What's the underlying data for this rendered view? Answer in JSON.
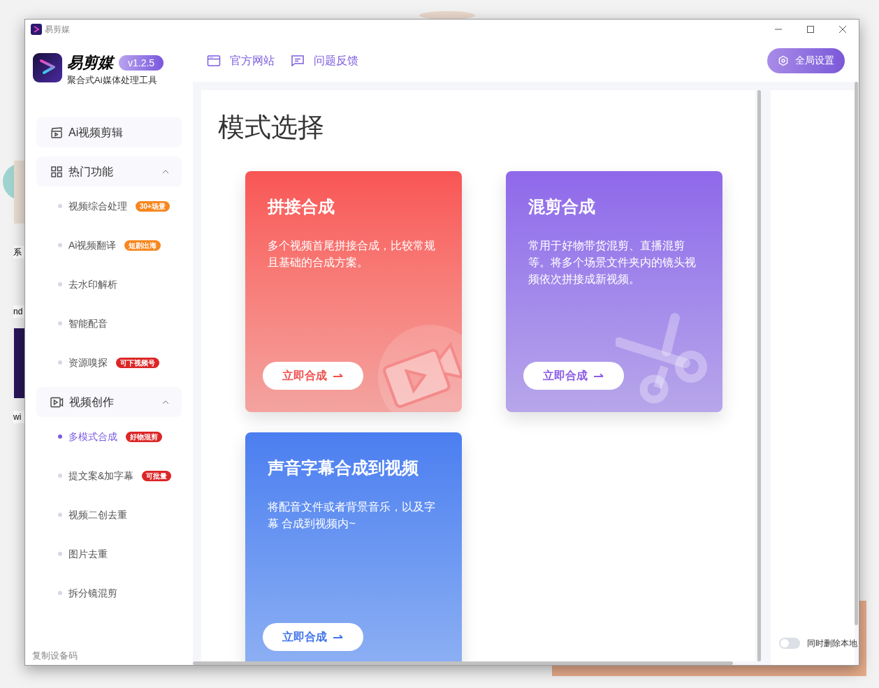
{
  "background_window": {
    "texts": [
      "系",
      "nd",
      "wi"
    ]
  },
  "window": {
    "title": "易剪媒"
  },
  "brand": {
    "name": "易剪媒",
    "version": "v1.2.5",
    "tagline": "聚合式Ai媒体处理工具"
  },
  "sidebar": {
    "items": [
      {
        "kind": "link",
        "label": "Ai视频剪辑"
      },
      {
        "kind": "group",
        "label": "热门功能",
        "expanded": true,
        "children": [
          {
            "label": "视频综合处理",
            "selected": false,
            "badge": {
              "text": "30+场景",
              "color": "#f7861e"
            }
          },
          {
            "label": "Ai视频翻译",
            "selected": false,
            "badge": {
              "text": "短剧出海",
              "color": "#f7861e"
            }
          },
          {
            "label": "去水印解析",
            "selected": false
          },
          {
            "label": "智能配音",
            "selected": false
          },
          {
            "label": "资源嗅探",
            "selected": false,
            "badge": {
              "text": "可下视频号",
              "color": "#dc2626"
            }
          }
        ]
      },
      {
        "kind": "group",
        "label": "视频创作",
        "expanded": true,
        "children": [
          {
            "label": "多模式合成",
            "selected": true,
            "badge": {
              "text": "好物混剪",
              "color": "#dc2626"
            }
          },
          {
            "label": "提文案&加字幕",
            "selected": false,
            "badge": {
              "text": "可批量",
              "color": "#dc2626"
            }
          },
          {
            "label": "视频二创去重",
            "selected": false
          },
          {
            "label": "图片去重",
            "selected": false
          },
          {
            "label": "拆分镜混剪",
            "selected": false
          }
        ]
      }
    ],
    "footer": "复制设备码"
  },
  "top_links": [
    {
      "label": "官方网站"
    },
    {
      "label": "问题反馈"
    }
  ],
  "settings_button": "全局设置",
  "page_title": "模式选择",
  "cards": [
    {
      "kind": "red",
      "title": "拼接合成",
      "description": "多个视频首尾拼接合成，比较常规且基础的合成方案。",
      "button": "立即合成"
    },
    {
      "kind": "purple",
      "title": "混剪合成",
      "description": "常用于好物带货混剪、直播混剪等。将多个场景文件夹内的镜头视频依次拼接成新视频。",
      "button": "立即合成"
    },
    {
      "kind": "blue",
      "title": "声音字幕合成到视频",
      "description": "将配音文件或者背景音乐，以及字幕 合成到视频内~",
      "button": "立即合成"
    }
  ],
  "right_panel": {
    "toggle": {
      "label": "同时删除本地",
      "on": false
    }
  }
}
